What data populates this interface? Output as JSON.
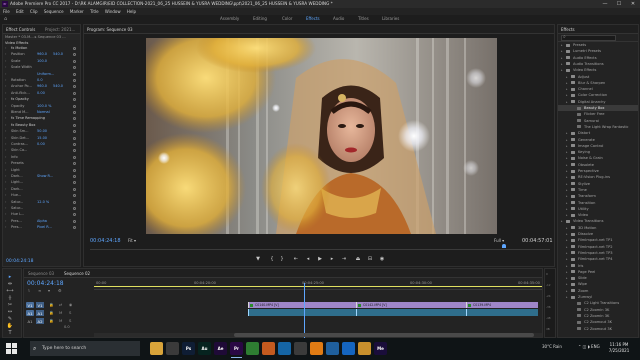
{
  "window": {
    "title": "Adobe Premiere Pro CC 2017 - D:\\RK ALAMGIR\\EID COLLECTION-2021_06_25 HUSSEIN & YUSRA WEDDING\\ppt\\2021_06_25 HUSSEIN & YUSRA WEDDING *",
    "icon_text": "Pr",
    "minimize": "—",
    "maximize": "☐",
    "close": "✕"
  },
  "menu": [
    "File",
    "Edit",
    "Clip",
    "Sequence",
    "Marker",
    "Title",
    "Window",
    "Help"
  ],
  "workspaces": {
    "items": [
      "Assembly",
      "Editing",
      "Color",
      "Effects",
      "Audio",
      "Titles",
      "Libraries"
    ],
    "active": "Effects"
  },
  "left_panel": {
    "tabs": [
      "Effect Controls",
      "Project: 2021..."
    ],
    "source_label": "Master * 03.M... ▸ Sequence 03 ...",
    "section_video": "Video Effects",
    "rows": [
      {
        "label": "fx  Motion",
        "v1": "",
        "v2": ""
      },
      {
        "label": "Position",
        "v1": "960.0",
        "v2": "540.0"
      },
      {
        "label": "Scale",
        "v1": "100.0",
        "v2": ""
      },
      {
        "label": "Scale Width",
        "v1": "",
        "v2": ""
      },
      {
        "label": "",
        "v1": "Uniform...",
        "v2": ""
      },
      {
        "label": "Rotation",
        "v1": "0.0",
        "v2": ""
      },
      {
        "label": "Anchor Po...",
        "v1": "960.0",
        "v2": "540.0"
      },
      {
        "label": "Anti-flick...",
        "v1": "0.00",
        "v2": ""
      },
      {
        "label": "fx  Opacity",
        "v1": "",
        "v2": ""
      },
      {
        "label": "Opacity",
        "v1": "100.0 %",
        "v2": ""
      },
      {
        "label": "Blend M...",
        "v1": "Normal",
        "v2": ""
      },
      {
        "label": "fx  Time Remapping",
        "v1": "",
        "v2": ""
      },
      {
        "label": "fx  Beauty Box",
        "v1": "",
        "v2": ""
      },
      {
        "label": "Skin Sm...",
        "v1": "50.00",
        "v2": ""
      },
      {
        "label": "Skin Det...",
        "v1": "15.00",
        "v2": ""
      },
      {
        "label": "Contras...",
        "v1": "0.00",
        "v2": ""
      },
      {
        "label": "Skin Co...",
        "v1": "",
        "v2": ""
      },
      {
        "label": "Info",
        "v1": "",
        "v2": ""
      },
      {
        "label": "Presets",
        "v1": "",
        "v2": ""
      },
      {
        "label": "Light",
        "v1": "",
        "v2": ""
      },
      {
        "label": "Dark...",
        "v1": "Show R...",
        "v2": ""
      },
      {
        "label": "Light...",
        "v1": "",
        "v2": ""
      },
      {
        "label": "Dark...",
        "v1": "",
        "v2": ""
      },
      {
        "label": "Hue...",
        "v1": "",
        "v2": ""
      },
      {
        "label": "Satur...",
        "v1": "12.0 %",
        "v2": ""
      },
      {
        "label": "Satur...",
        "v1": "",
        "v2": ""
      },
      {
        "label": "Hue L...",
        "v1": "",
        "v2": ""
      },
      {
        "label": "Pres...",
        "v1": "Alpha",
        "v2": ""
      },
      {
        "label": "Pres...",
        "v1": "Pixel R...",
        "v2": ""
      }
    ],
    "timecode": "00:04:24:18"
  },
  "program_monitor": {
    "tab": "Program: Sequence 03",
    "timecode_current": "00:04:24:18",
    "fit": "Fit",
    "quality": "Full",
    "timecode_duration": "00:04:57:01",
    "playhead_fraction": 0.9
  },
  "effects_panel": {
    "tab": "Effects",
    "items": [
      {
        "label": "Presets",
        "level": 1,
        "selected": false
      },
      {
        "label": "Lumetri Presets",
        "level": 1,
        "selected": false
      },
      {
        "label": "Audio Effects",
        "level": 1,
        "selected": false
      },
      {
        "label": "Audio Transitions",
        "level": 1,
        "selected": false
      },
      {
        "label": "Video Effects",
        "level": 1,
        "selected": false
      },
      {
        "label": "Adjust",
        "level": 2,
        "selected": false
      },
      {
        "label": "Blur & Sharpen",
        "level": 2,
        "selected": false
      },
      {
        "label": "Channel",
        "level": 2,
        "selected": false
      },
      {
        "label": "Color Correction",
        "level": 2,
        "selected": false
      },
      {
        "label": "Digital Anarchy",
        "level": 2,
        "selected": false
      },
      {
        "label": "Beauty Box",
        "level": 3,
        "selected": true
      },
      {
        "label": "Flicker Free",
        "level": 3,
        "selected": false
      },
      {
        "label": "Samurai",
        "level": 3,
        "selected": false
      },
      {
        "label": "The Light Wrap Fantastic",
        "level": 3,
        "selected": false
      },
      {
        "label": "Distort",
        "level": 2,
        "selected": false
      },
      {
        "label": "Generate",
        "level": 2,
        "selected": false
      },
      {
        "label": "Image Control",
        "level": 2,
        "selected": false
      },
      {
        "label": "Keying",
        "level": 2,
        "selected": false
      },
      {
        "label": "Noise & Grain",
        "level": 2,
        "selected": false
      },
      {
        "label": "Obsolete",
        "level": 2,
        "selected": false
      },
      {
        "label": "Perspective",
        "level": 2,
        "selected": false
      },
      {
        "label": "RE:Vision Plug-ins",
        "level": 2,
        "selected": false
      },
      {
        "label": "Stylize",
        "level": 2,
        "selected": false
      },
      {
        "label": "Time",
        "level": 2,
        "selected": false
      },
      {
        "label": "Transform",
        "level": 2,
        "selected": false
      },
      {
        "label": "Transition",
        "level": 2,
        "selected": false
      },
      {
        "label": "Utility",
        "level": 2,
        "selected": false
      },
      {
        "label": "Video",
        "level": 2,
        "selected": false
      },
      {
        "label": "Video Transitions",
        "level": 1,
        "selected": false
      },
      {
        "label": "3D Motion",
        "level": 2,
        "selected": false
      },
      {
        "label": "Dissolve",
        "level": 2,
        "selected": false
      },
      {
        "label": "FilmImpact.net TP1",
        "level": 2,
        "selected": false
      },
      {
        "label": "FilmImpact.net TP2",
        "level": 2,
        "selected": false
      },
      {
        "label": "FilmImpact.net TP3",
        "level": 2,
        "selected": false
      },
      {
        "label": "FilmImpact.net TP4",
        "level": 2,
        "selected": false
      },
      {
        "label": "Iris",
        "level": 2,
        "selected": false
      },
      {
        "label": "Page Peel",
        "level": 2,
        "selected": false
      },
      {
        "label": "Slide",
        "level": 2,
        "selected": false
      },
      {
        "label": "Wipe",
        "level": 2,
        "selected": false
      },
      {
        "label": "Zoom",
        "level": 2,
        "selected": false
      },
      {
        "label": "Zumwyl",
        "level": 2,
        "selected": false
      },
      {
        "label": "C2 Light Transitions",
        "level": 3,
        "selected": false
      },
      {
        "label": "C2 Zoomin 3K",
        "level": 3,
        "selected": false
      },
      {
        "label": "C2 Zoomin 3K",
        "level": 3,
        "selected": false
      },
      {
        "label": "C2 Zoomout 3K",
        "level": 3,
        "selected": false
      },
      {
        "label": "C2 Zoomout 3K",
        "level": 3,
        "selected": false
      }
    ]
  },
  "timeline": {
    "tabs": [
      "Sequence 03",
      "Sequence 02"
    ],
    "timecode": "00:04:24:18",
    "ruler": [
      "00:00",
      "00:04:20:00",
      "00:04:25:00",
      "00:04:30:00",
      "00:04:35:00"
    ],
    "tracks": [
      {
        "name": "V1",
        "id": "V1"
      },
      {
        "name": "A1",
        "id": "A1"
      },
      {
        "name": "A1",
        "id": "A2"
      }
    ],
    "clips": [
      {
        "label": "C0140.MP4 [V]",
        "track": 0
      },
      {
        "label": "C0142.MP4 [V]",
        "track": 0
      },
      {
        "label": "C0139.MP4",
        "track": 0
      }
    ],
    "footer_value": "0.0"
  },
  "meter": {
    "labels": [
      "0",
      "-12",
      "-24",
      "-36",
      "-48",
      "dB"
    ]
  },
  "tools": [
    "▸",
    "⇹",
    "⟷",
    "⟠",
    "✂",
    "↔",
    "✎",
    "✋",
    "T"
  ],
  "taskbar": {
    "search_placeholder": "Type here to search",
    "apps": [
      {
        "icon": "file-explorer-icon",
        "text": "",
        "color": "#d9a43a"
      },
      {
        "icon": "task-view-icon",
        "text": "",
        "color": "#3a3a3a"
      },
      {
        "icon": "photoshop-icon",
        "text": "Ps",
        "color": "#0f1d34"
      },
      {
        "icon": "audition-icon",
        "text": "Au",
        "color": "#06231f"
      },
      {
        "icon": "after-effects-icon",
        "text": "Ae",
        "color": "#1f0a37"
      },
      {
        "icon": "premiere-icon",
        "text": "Pr",
        "color": "#2a0844"
      },
      {
        "icon": "chrome-icon",
        "text": "",
        "color": "#2e7d32"
      },
      {
        "icon": "firefox-icon",
        "text": "",
        "color": "#c45a1f"
      },
      {
        "icon": "edge-icon",
        "text": "",
        "color": "#1565a5"
      },
      {
        "icon": "store-icon",
        "text": "",
        "color": "#3b3b3b"
      },
      {
        "icon": "vlc-icon",
        "text": "",
        "color": "#e07b14"
      },
      {
        "icon": "photos-icon",
        "text": "",
        "color": "#1f5f9d"
      },
      {
        "icon": "mail-icon",
        "text": "",
        "color": "#1565c0"
      },
      {
        "icon": "folder-icon",
        "text": "",
        "color": "#c9902d"
      },
      {
        "icon": "media-encoder-icon",
        "text": "Me",
        "color": "#1a0d3a"
      }
    ],
    "weather": "30°C  Rain",
    "time": "11:16 PM",
    "date": "7/25/2021"
  }
}
